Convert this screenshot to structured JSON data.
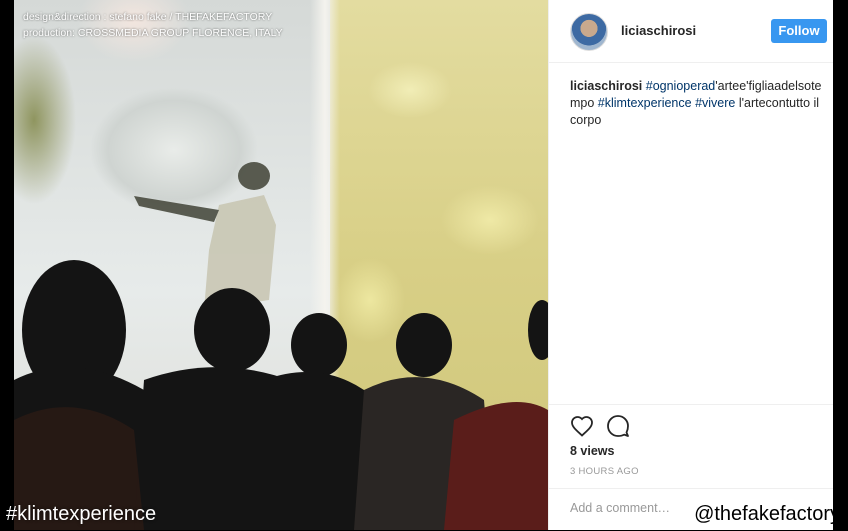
{
  "overlay": {
    "credit_line1": "design&direction : stefano fake / THEFAKEFACTORY",
    "credit_line2": "production: CROSSMEDIA GROUP FLORENCE, ITALY",
    "hashtag": "#klimtexperience",
    "handle": "@thefakefactory"
  },
  "post": {
    "username": "liciaschirosi",
    "follow_label": "Follow",
    "caption": {
      "user": "liciaschirosi",
      "parts": [
        {
          "text": "#ognioperad",
          "tag": true
        },
        {
          "text": "'artee'figliaadelsotempo ",
          "tag": false
        },
        {
          "text": "#klimtexperience",
          "tag": true
        },
        {
          "text": " ",
          "tag": false
        },
        {
          "text": "#vivere",
          "tag": true
        },
        {
          "text": " l'artecontutto il corpo",
          "tag": false
        }
      ]
    },
    "views": "8 views",
    "time": "3 HOURS AGO",
    "comment_placeholder": "Add a comment…"
  },
  "icons": {
    "heart": "heart-icon",
    "comment": "comment-icon"
  },
  "colors": {
    "follow_button": "#3897f0",
    "hashtag_link": "#003569",
    "muted_text": "#999999"
  }
}
